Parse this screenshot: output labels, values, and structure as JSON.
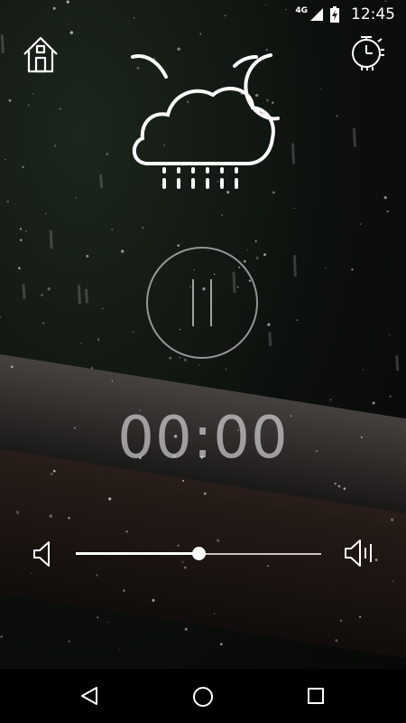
{
  "status_bar": {
    "network": "4G",
    "time": "12:45"
  },
  "top_bar": {
    "home_icon": "home-icon",
    "timer_icon": "timer-icon"
  },
  "weather": {
    "icon": "cloud-moon-rain-icon"
  },
  "player": {
    "state": "paused",
    "icon": "pause-icon",
    "elapsed": "00:00"
  },
  "volume": {
    "level": 0.5,
    "low_icon": "volume-low-icon",
    "high_icon": "volume-high-icon"
  },
  "nav": {
    "back_icon": "back-icon",
    "home_icon": "nav-home-icon",
    "recents_icon": "recents-icon"
  }
}
